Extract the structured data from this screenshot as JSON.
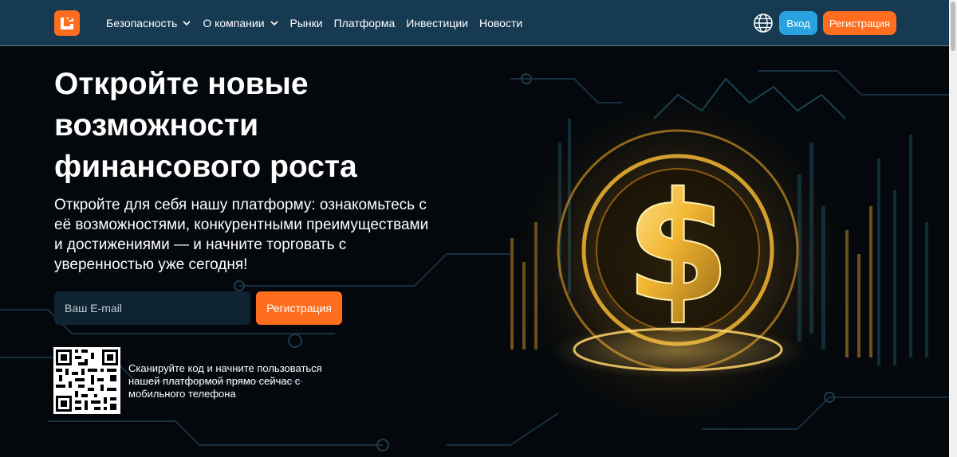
{
  "nav": {
    "items": [
      {
        "label": "Безопасность",
        "has_dropdown": true
      },
      {
        "label": "О компании",
        "has_dropdown": true
      },
      {
        "label": "Рынки",
        "has_dropdown": false
      },
      {
        "label": "Платформа",
        "has_dropdown": false
      },
      {
        "label": "Инвестиции",
        "has_dropdown": false
      },
      {
        "label": "Новости",
        "has_dropdown": false
      }
    ],
    "login_label": "Вход",
    "register_label": "Регистрация"
  },
  "hero": {
    "title_lines": [
      "Откройте новые",
      "возможности",
      "финансового роста"
    ],
    "subtitle_lines": [
      "Откройте для себя нашу платформу: ознакомьтесь с",
      "её возможностями, конкурентными преимуществами",
      "и достижениями — и начните торговать с",
      "уверенностью уже сегодня!"
    ],
    "email_placeholder": "Ваш E-mail",
    "register_label": "Регистрация",
    "qr_text_lines": [
      "Сканируйте код и начните пользоваться",
      "нашей платформой прямо сейчас с",
      "мобильного телефона"
    ]
  },
  "colors": {
    "navbar_bg": "#163a52",
    "accent_orange": "#ff6d1f",
    "accent_blue": "#29a3e0",
    "page_bg": "#04080c",
    "gold": "#f5c542"
  },
  "icons": {
    "logo": "brand-logo",
    "globe": "globe-icon",
    "chevron": "chevron-down-icon",
    "hero_image": "dollar-coin-illustration"
  }
}
